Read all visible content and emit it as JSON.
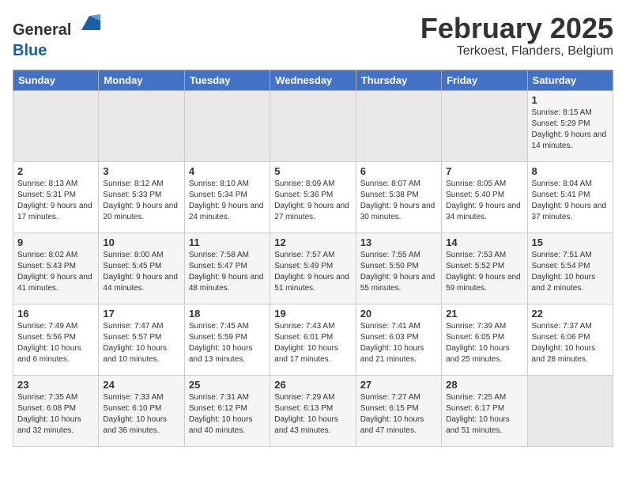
{
  "header": {
    "logo_general": "General",
    "logo_blue": "Blue",
    "title": "February 2025",
    "subtitle": "Terkoest, Flanders, Belgium"
  },
  "days_of_week": [
    "Sunday",
    "Monday",
    "Tuesday",
    "Wednesday",
    "Thursday",
    "Friday",
    "Saturday"
  ],
  "weeks": [
    [
      {
        "day": "",
        "info": ""
      },
      {
        "day": "",
        "info": ""
      },
      {
        "day": "",
        "info": ""
      },
      {
        "day": "",
        "info": ""
      },
      {
        "day": "",
        "info": ""
      },
      {
        "day": "",
        "info": ""
      },
      {
        "day": "1",
        "info": "Sunrise: 8:15 AM\nSunset: 5:29 PM\nDaylight: 9 hours and 14 minutes."
      }
    ],
    [
      {
        "day": "2",
        "info": "Sunrise: 8:13 AM\nSunset: 5:31 PM\nDaylight: 9 hours and 17 minutes."
      },
      {
        "day": "3",
        "info": "Sunrise: 8:12 AM\nSunset: 5:33 PM\nDaylight: 9 hours and 20 minutes."
      },
      {
        "day": "4",
        "info": "Sunrise: 8:10 AM\nSunset: 5:34 PM\nDaylight: 9 hours and 24 minutes."
      },
      {
        "day": "5",
        "info": "Sunrise: 8:09 AM\nSunset: 5:36 PM\nDaylight: 9 hours and 27 minutes."
      },
      {
        "day": "6",
        "info": "Sunrise: 8:07 AM\nSunset: 5:38 PM\nDaylight: 9 hours and 30 minutes."
      },
      {
        "day": "7",
        "info": "Sunrise: 8:05 AM\nSunset: 5:40 PM\nDaylight: 9 hours and 34 minutes."
      },
      {
        "day": "8",
        "info": "Sunrise: 8:04 AM\nSunset: 5:41 PM\nDaylight: 9 hours and 37 minutes."
      }
    ],
    [
      {
        "day": "9",
        "info": "Sunrise: 8:02 AM\nSunset: 5:43 PM\nDaylight: 9 hours and 41 minutes."
      },
      {
        "day": "10",
        "info": "Sunrise: 8:00 AM\nSunset: 5:45 PM\nDaylight: 9 hours and 44 minutes."
      },
      {
        "day": "11",
        "info": "Sunrise: 7:58 AM\nSunset: 5:47 PM\nDaylight: 9 hours and 48 minutes."
      },
      {
        "day": "12",
        "info": "Sunrise: 7:57 AM\nSunset: 5:49 PM\nDaylight: 9 hours and 51 minutes."
      },
      {
        "day": "13",
        "info": "Sunrise: 7:55 AM\nSunset: 5:50 PM\nDaylight: 9 hours and 55 minutes."
      },
      {
        "day": "14",
        "info": "Sunrise: 7:53 AM\nSunset: 5:52 PM\nDaylight: 9 hours and 59 minutes."
      },
      {
        "day": "15",
        "info": "Sunrise: 7:51 AM\nSunset: 5:54 PM\nDaylight: 10 hours and 2 minutes."
      }
    ],
    [
      {
        "day": "16",
        "info": "Sunrise: 7:49 AM\nSunset: 5:56 PM\nDaylight: 10 hours and 6 minutes."
      },
      {
        "day": "17",
        "info": "Sunrise: 7:47 AM\nSunset: 5:57 PM\nDaylight: 10 hours and 10 minutes."
      },
      {
        "day": "18",
        "info": "Sunrise: 7:45 AM\nSunset: 5:59 PM\nDaylight: 10 hours and 13 minutes."
      },
      {
        "day": "19",
        "info": "Sunrise: 7:43 AM\nSunset: 6:01 PM\nDaylight: 10 hours and 17 minutes."
      },
      {
        "day": "20",
        "info": "Sunrise: 7:41 AM\nSunset: 6:03 PM\nDaylight: 10 hours and 21 minutes."
      },
      {
        "day": "21",
        "info": "Sunrise: 7:39 AM\nSunset: 6:05 PM\nDaylight: 10 hours and 25 minutes."
      },
      {
        "day": "22",
        "info": "Sunrise: 7:37 AM\nSunset: 6:06 PM\nDaylight: 10 hours and 28 minutes."
      }
    ],
    [
      {
        "day": "23",
        "info": "Sunrise: 7:35 AM\nSunset: 6:08 PM\nDaylight: 10 hours and 32 minutes."
      },
      {
        "day": "24",
        "info": "Sunrise: 7:33 AM\nSunset: 6:10 PM\nDaylight: 10 hours and 36 minutes."
      },
      {
        "day": "25",
        "info": "Sunrise: 7:31 AM\nSunset: 6:12 PM\nDaylight: 10 hours and 40 minutes."
      },
      {
        "day": "26",
        "info": "Sunrise: 7:29 AM\nSunset: 6:13 PM\nDaylight: 10 hours and 43 minutes."
      },
      {
        "day": "27",
        "info": "Sunrise: 7:27 AM\nSunset: 6:15 PM\nDaylight: 10 hours and 47 minutes."
      },
      {
        "day": "28",
        "info": "Sunrise: 7:25 AM\nSunset: 6:17 PM\nDaylight: 10 hours and 51 minutes."
      },
      {
        "day": "",
        "info": ""
      }
    ]
  ]
}
